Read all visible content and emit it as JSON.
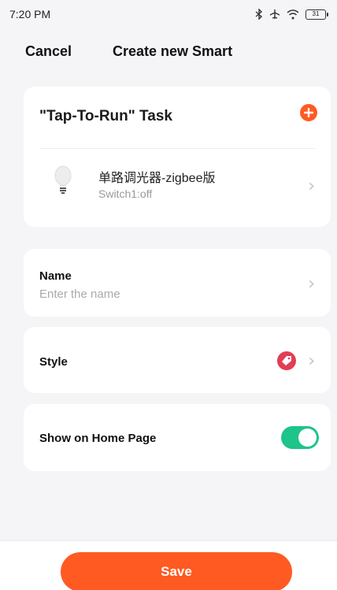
{
  "status_bar": {
    "time": "7:20 PM",
    "bluetooth_icon": "bluetooth-icon",
    "airplane_icon": "airplane-icon",
    "wifi_icon": "wifi-icon",
    "battery_level": "31"
  },
  "nav": {
    "cancel_label": "Cancel",
    "title": "Create new Smart"
  },
  "task": {
    "title": "\"Tap-To-Run\" Task",
    "add_icon": "plus-circle-icon",
    "device": {
      "icon": "lightbulb-icon",
      "name": "单路调光器-zigbee版",
      "status": "Switch1:off"
    }
  },
  "name_field": {
    "label": "Name",
    "placeholder": "Enter the name"
  },
  "style_field": {
    "label": "Style",
    "icon": "tag-icon",
    "icon_color": "#e23e55"
  },
  "home_page": {
    "label": "Show on Home Page",
    "enabled": true,
    "toggle_color": "#1ec48a"
  },
  "footer": {
    "save_label": "Save",
    "accent_color": "#ff5a22"
  }
}
